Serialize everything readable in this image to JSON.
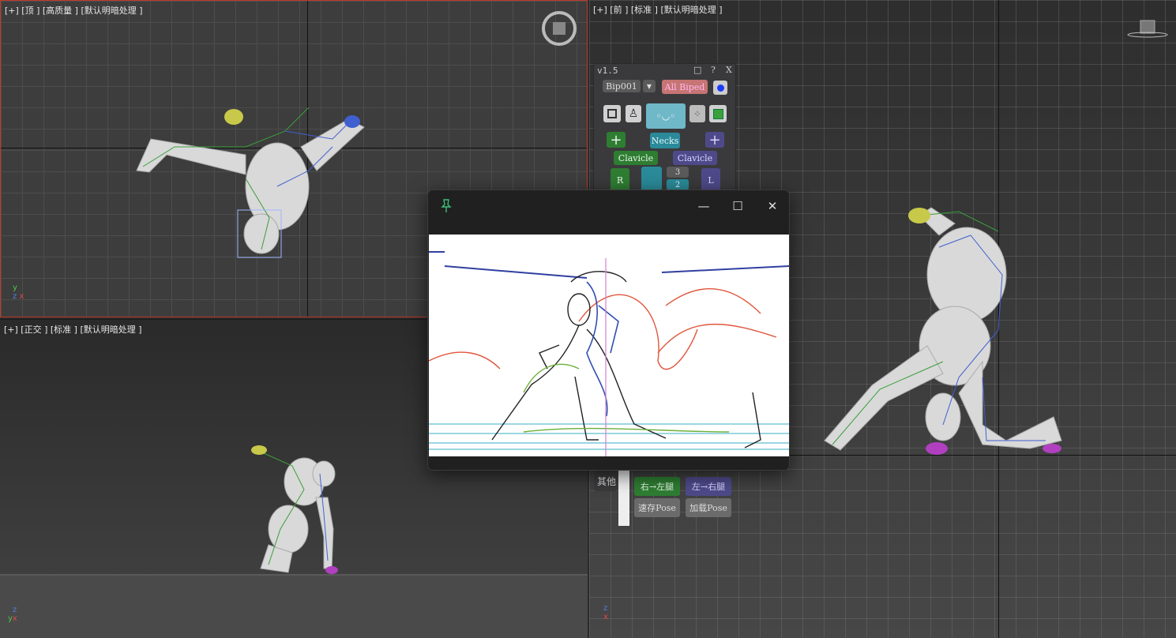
{
  "viewports": {
    "top": {
      "label": "[+] [顶 ] [高质量 ] [默认明暗处理 ]"
    },
    "front": {
      "label": "[+] [前 ] [标准 ] [默认明暗处理 ]"
    },
    "ortho": {
      "label": "[+] [正交 ] [标准 ] [默认明暗处理 ]"
    }
  },
  "axes": {
    "y": "y",
    "z": "z",
    "x": "x"
  },
  "tool_panel": {
    "version": "v1.5",
    "ctrl_restore": "□",
    "ctrl_help": "?",
    "ctrl_close": "X",
    "biped_select": "Bip001",
    "dropdown_arrow": "▼",
    "all_biped": "All Biped",
    "neck_button": "Necks",
    "add_left": "+",
    "add_right": "+",
    "clavicle_r": "Clavicle",
    "clavicle_l": "Clavicle",
    "r_button": "R",
    "l_button": "L",
    "num_3": "3",
    "num_2": "2",
    "other_label": "其他",
    "right_to_left_leg": "右→左腿",
    "left_to_right_leg": "左→右腿",
    "save_pose": "速存Pose",
    "load_pose": "加载Pose"
  },
  "float_window": {
    "pin_icon": "pin-icon",
    "minimize": "—",
    "maximize": "☐",
    "close": "✕"
  },
  "colors": {
    "accent_green": "#2e7d32",
    "accent_teal": "#2b8a99",
    "accent_purple": "#4e4a8a",
    "active_border": "#c0392b"
  }
}
